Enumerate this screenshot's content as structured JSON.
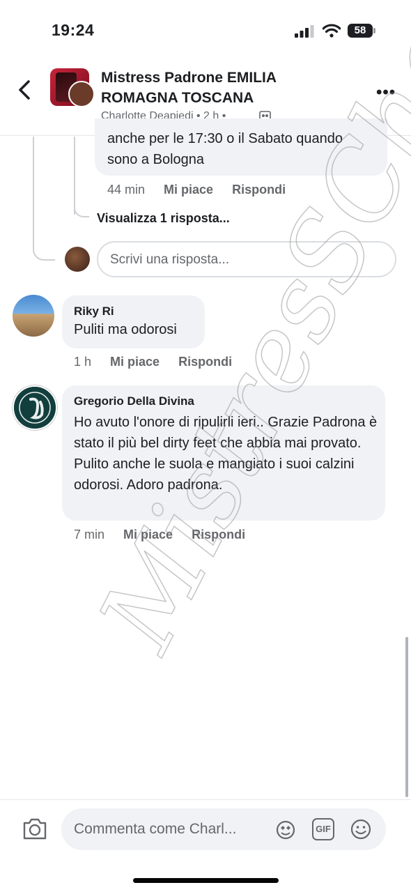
{
  "status_bar": {
    "time": "19:24",
    "battery": "58"
  },
  "header": {
    "title": "Mistress Padrone  EMILIA ROMAGNA TOSCANA",
    "subtitle": "Charlotte Deapiedi • 2 h •"
  },
  "thread": {
    "prev_reply": {
      "text_line1": "anche per le 17:30 o il Sabato quando",
      "text_line2": "sono a Bologna",
      "time": "44 min",
      "like": "Mi piace",
      "reply": "Rispondi"
    },
    "view_replies": "Visualizza 1 risposta...",
    "reply_placeholder": "Scrivi una risposta..."
  },
  "comments": [
    {
      "author": "Riky Ri",
      "text": "Puliti ma odorosi",
      "time": "1 h",
      "like": "Mi piace",
      "reply": "Rispondi"
    },
    {
      "author": "Gregorio Della Divina",
      "text": "Ho avuto l'onore di ripulirli ieri.. Grazie Padrona è stato il più bel dirty feet che abbia mai provato.  Pulito anche le suola e mangiato i suoi calzini odorosi. Adoro padrona.",
      "time": "7 min",
      "like": "Mi piace",
      "reply": "Rispondi"
    }
  ],
  "composer": {
    "placeholder": "Commenta come Charl...",
    "gif_label": "GIF"
  },
  "watermark": "MistresSCharlotte",
  "colors": {
    "bubble": "#f0f2f5",
    "secondary_text": "#65676b",
    "text": "#1c1e21"
  }
}
